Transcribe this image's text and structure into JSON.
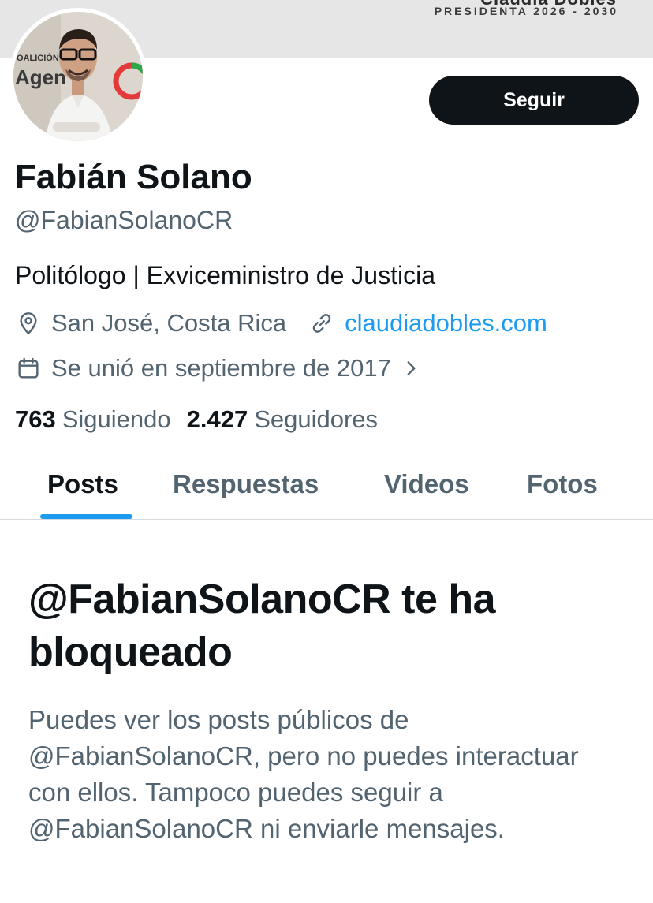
{
  "banner": {
    "top_text": "Claudia Dobles",
    "subtitle": "PRESIDENTA 2026 - 2030"
  },
  "profile": {
    "avatar_badge_text": "OALICIÓN",
    "avatar_sign_text": "Agen",
    "follow_label": "Seguir",
    "name": "Fabián Solano",
    "handle": "@FabianSolanoCR",
    "bio": "Politólogo | Exviceministro de Justicia",
    "location": "San José, Costa Rica",
    "website": "claudiadobles.com",
    "joined": "Se unió en septiembre de 2017",
    "following_count": "763",
    "following_label": "Siguiendo",
    "followers_count": "2.427",
    "followers_label": "Seguidores"
  },
  "tabs": [
    {
      "label": "Posts",
      "active": true
    },
    {
      "label": "Respuestas",
      "active": false
    },
    {
      "label": "Videos",
      "active": false
    },
    {
      "label": "Fotos",
      "active": false
    }
  ],
  "blocked": {
    "title": "@FabianSolanoCR te ha bloqueado",
    "body": "Puedes ver los posts públicos de @FabianSolanoCR, pero no puedes interactuar con ellos. Tampoco puedes seguir a @FabianSolanoCR ni enviarle mensajes."
  },
  "icons": {
    "location": "location-pin-icon",
    "link": "link-icon",
    "calendar": "calendar-icon",
    "chevron": "chevron-right-icon"
  },
  "colors": {
    "accent": "#1d9bf0",
    "text_primary": "#0f1419",
    "text_secondary": "#536471",
    "button_bg": "#0f1419"
  }
}
